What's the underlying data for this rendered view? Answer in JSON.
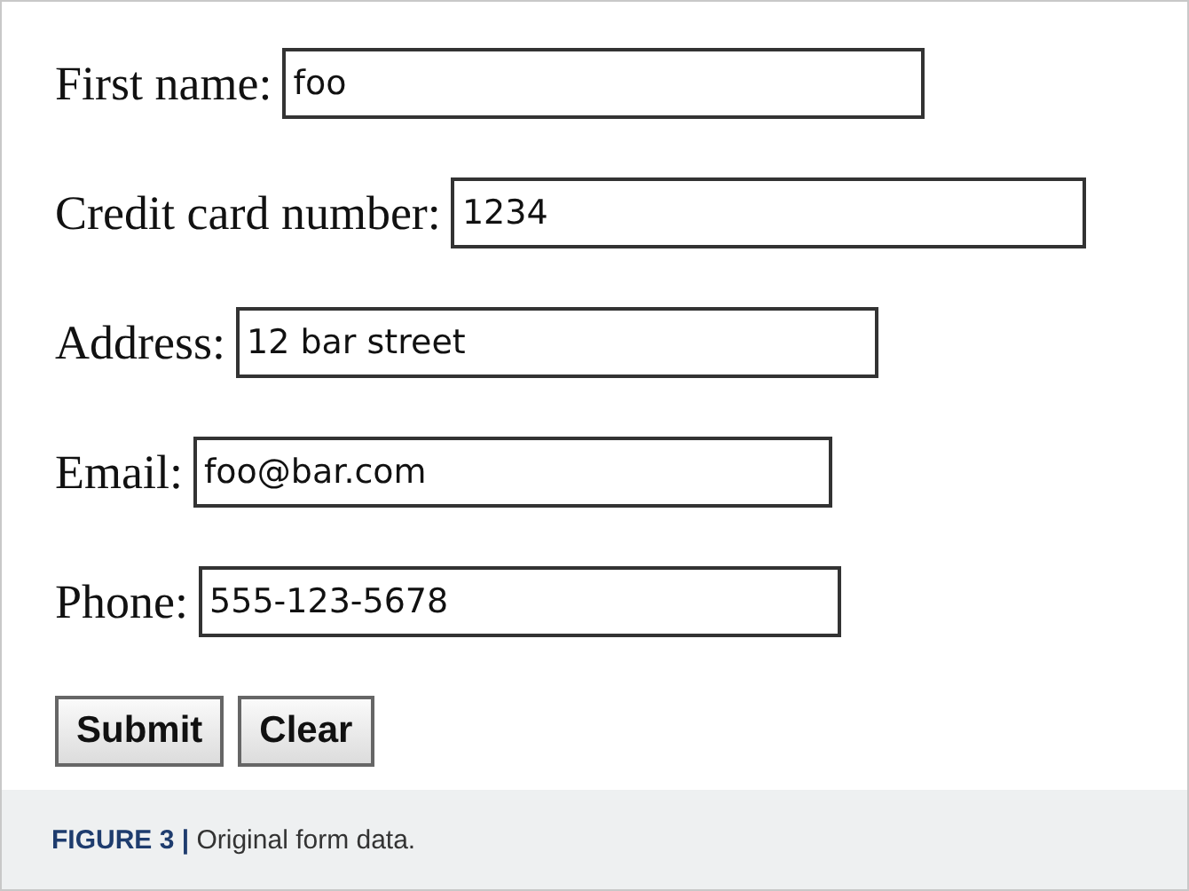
{
  "form": {
    "fields": [
      {
        "label": "First name:",
        "value": "foo"
      },
      {
        "label": "Credit card number:",
        "value": "1234"
      },
      {
        "label": "Address:",
        "value": "12 bar street"
      },
      {
        "label": "Email:",
        "value": "foo@bar.com"
      },
      {
        "label": "Phone:",
        "value": "555-123-5678"
      }
    ],
    "buttons": [
      "Submit",
      "Clear"
    ]
  },
  "caption": "**FIGURE 3 |** Original form data."
}
